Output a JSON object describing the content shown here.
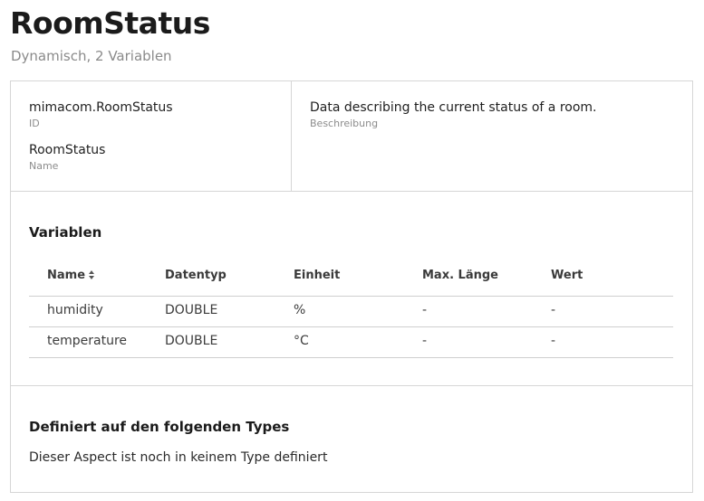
{
  "header": {
    "title": "RoomStatus",
    "subtitle": "Dynamisch, 2 Variablen"
  },
  "info": {
    "id_value": "mimacom.RoomStatus",
    "id_label": "ID",
    "name_value": "RoomStatus",
    "name_label": "Name",
    "description_value": "Data describing the current status of a room.",
    "description_label": "Beschreibung"
  },
  "variables": {
    "title": "Variablen",
    "columns": [
      "Name",
      "Datentyp",
      "Einheit",
      "Max. Länge",
      "Wert"
    ],
    "rows": [
      [
        "humidity",
        "DOUBLE",
        "%",
        "-",
        "-"
      ],
      [
        "temperature",
        "DOUBLE",
        "°C",
        "-",
        "-"
      ]
    ]
  },
  "types": {
    "title": "Definiert auf den folgenden Types",
    "empty_text": "Dieser Aspect ist noch in keinem Type definiert"
  }
}
